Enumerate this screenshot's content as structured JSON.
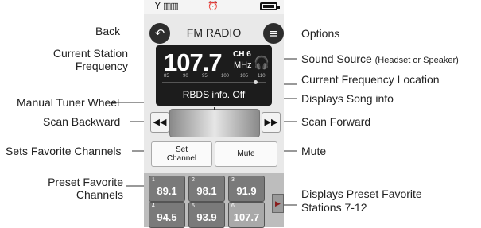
{
  "callouts": {
    "back": "Back",
    "current_station": "Current Station",
    "frequency": "Frequency",
    "manual_tuner": "Manual Tuner Wheel",
    "scan_backward": "Scan Backward",
    "sets_favorite": "Sets Favorite Channels",
    "preset_favorite": "Preset Favorite",
    "channels": "Channels",
    "options": "Options",
    "sound_source": "Sound Source",
    "sound_source_note": "(Headset or Speaker)",
    "current_freq_location": "Current Frequency Location",
    "displays_song": "Displays Song info",
    "scan_forward": "Scan Forward",
    "mute": "Mute",
    "displays_preset_1": "Displays Preset Favorite",
    "displays_preset_2": "Stations 7-12"
  },
  "phone": {
    "title": "FM RADIO",
    "frequency": "107.7",
    "channel": "CH 6",
    "unit": "MHz",
    "scale_ticks": [
      "85",
      "90",
      "95",
      "100",
      "105",
      "110"
    ],
    "rbds": "RBDS info. Off",
    "set_channel_1": "Set",
    "set_channel_2": "Channel",
    "mute_label": "Mute",
    "scan_back_symbol": "◀◀",
    "scan_forward_symbol": "▶▶",
    "next_symbol": "▶",
    "presets": [
      {
        "num": "1",
        "freq": "89.1"
      },
      {
        "num": "2",
        "freq": "98.1"
      },
      {
        "num": "3",
        "freq": "91.9"
      },
      {
        "num": "4",
        "freq": "94.5"
      },
      {
        "num": "5",
        "freq": "93.9"
      },
      {
        "num": "6",
        "freq": "107.7"
      }
    ]
  },
  "icons": {
    "back": "back-arrow-icon",
    "options": "options-menu-icon",
    "headset": "headset-icon",
    "signal": "signal-icon",
    "battery": "battery-icon"
  }
}
